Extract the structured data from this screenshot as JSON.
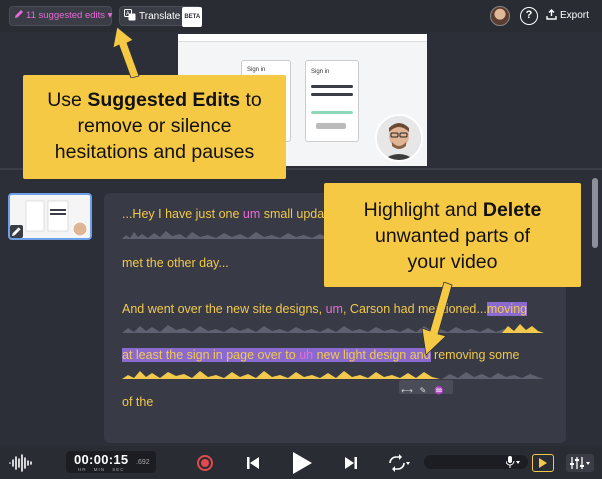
{
  "topbar": {
    "suggested_edits_label": "11 suggested edits ▾",
    "translate_label": "Translate",
    "beta_badge": "BETA",
    "export_label": "Export",
    "help_symbol": "?"
  },
  "callouts": {
    "left": {
      "line1_pre": "Use ",
      "line1_bold": "Suggested Edits",
      "line1_post": " to",
      "line2": "remove or silence",
      "line3": "hesitations and pauses"
    },
    "right": {
      "line1_pre": "Highlight and ",
      "line1_bold": "Delete",
      "line2": "unwanted parts of",
      "line3": "your video"
    }
  },
  "video_preview": {
    "card_left_title": "Sign in",
    "card_right_title": "Sign in"
  },
  "transcript": {
    "lines": [
      {
        "text_before": "...Hey I have just one ",
        "filler": "um",
        "text_after": " small upda"
      },
      {
        "text": "met the other day..."
      },
      {
        "text_before": "And went over the new site designs, ",
        "filler": "um",
        "text_mid": ", Carson had mentioned...",
        "highlight": "moving"
      },
      {
        "highlight_before": "at least the sign in page over to ",
        "highlight_filler": "uh",
        "highlight_after": " new light design and",
        "text_after": " removing some"
      },
      {
        "text": "of the"
      }
    ]
  },
  "playback": {
    "timecode": "00:00:15",
    "timecode_fraction": ".692",
    "units": "HR MIN SEC"
  },
  "colors": {
    "accent_yellow": "#f6c944",
    "filler_pink": "#e86bd8",
    "selection_purple": "#8b6ad0",
    "transcript_text": "#f2c94c",
    "record_red": "#e04a4a"
  },
  "icons": [
    "pencil-icon",
    "translate-icon",
    "help-icon",
    "export-icon",
    "waveform-icon",
    "record-icon",
    "skip-back-icon",
    "play-icon",
    "skip-forward-icon",
    "loop-icon",
    "microphone-icon",
    "captions-icon",
    "mixer-icon"
  ]
}
